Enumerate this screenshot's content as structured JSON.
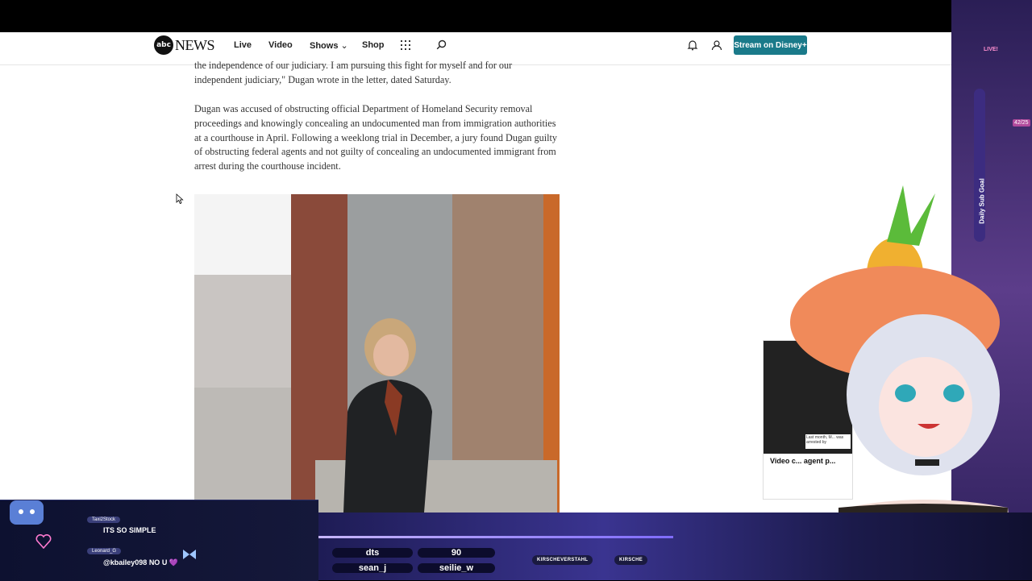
{
  "nav": {
    "logo_badge": "abc",
    "logo_text": "NEWS",
    "links": [
      "Live",
      "Video",
      "Shows",
      "Shop"
    ],
    "shows_chevron": "⌄",
    "stream_button": "Stream on Disney+"
  },
  "article": {
    "para1_line1": "the independence of our judiciary. I am pursuing this fight for myself and for our",
    "para1_line2": "independent judiciary,\" Dugan wrote in the letter, dated Saturday.",
    "para2": "Dugan was accused of obstructing official Department of Homeland Security removal proceedings and knowingly concealing an undocumented man from immigration authorities at a courthouse in April. Following a weeklong trial in December, a jury found Dugan guilty of obstructing federal agents and not guilty of concealing an undocumented immigrant from arrest during the courthouse incident."
  },
  "side_video": {
    "caption": "Last month, M... was arrested by",
    "title": "Video c... agent p..."
  },
  "chat": [
    {
      "user": "Taxi2Stock",
      "message": "ITS SO SIMPLE"
    },
    {
      "user": "Leonard_G",
      "message": "@kbailey098 NO U 💜"
    }
  ],
  "stream_bar": {
    "pill1": "dts",
    "pill2": "90",
    "pill3": "sean_j",
    "pill4": "seilie_w",
    "tag1": "KIRSCHEVERSTAHL",
    "tag2": "KIRSCHE"
  },
  "goal": {
    "label": "Daily Sub Goal",
    "count": "42/25",
    "live": "LIVE!"
  },
  "colors": {
    "stream_button": "#1a7a8a",
    "overlay_bg": "#15183a",
    "bar_accent": "#7f6cff"
  }
}
